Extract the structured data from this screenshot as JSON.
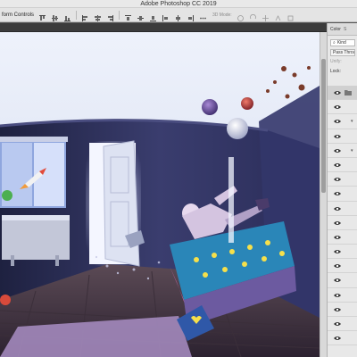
{
  "app": {
    "title": "Adobe Photoshop CC 2019"
  },
  "options_bar": {
    "transform_label": "form Controls",
    "mode_3d_label": "3D Mode:"
  },
  "panel": {
    "tabs": [
      "Color",
      "S"
    ],
    "search_kind": "Kind",
    "blend_mode": "Pass Throu",
    "unify_label": "Unify:",
    "lock_label": "Lock:"
  },
  "colors": {
    "accent": "#2d6fd1",
    "panel_bg": "#e8e8e8",
    "canvas_bg": "#5a5a5a"
  }
}
